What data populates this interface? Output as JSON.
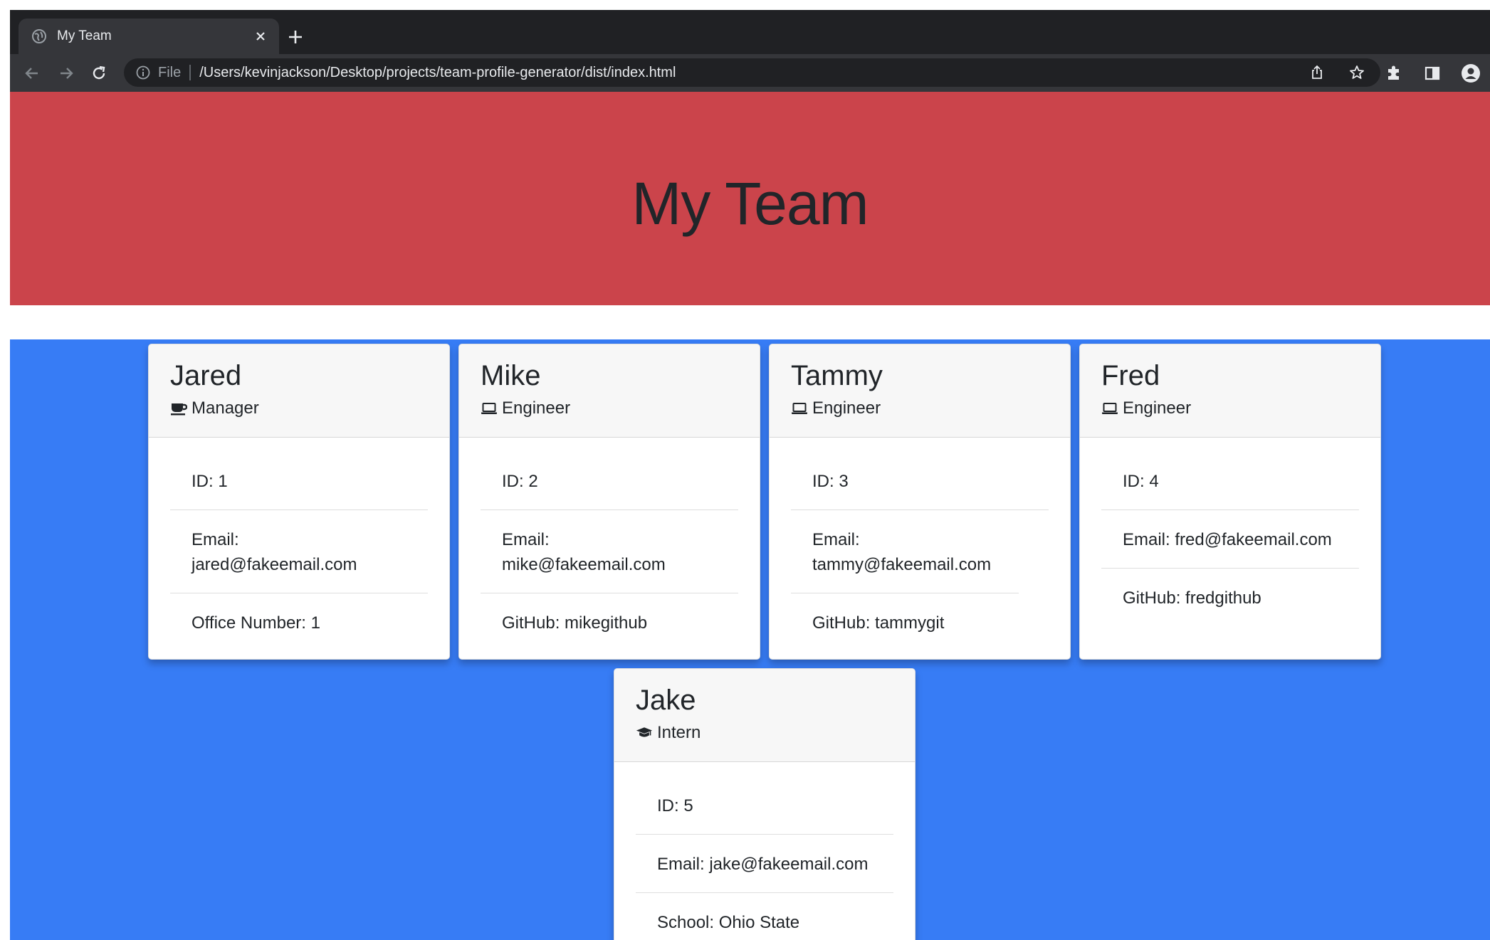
{
  "browser": {
    "tab_title": "My Team",
    "new_tab": "+",
    "url_scheme": "File",
    "url": "/Users/kevinjackson/Desktop/projects/team-profile-generator/dist/index.html"
  },
  "page": {
    "heading": "My Team"
  },
  "cards": [
    {
      "name": "Jared",
      "role": "Manager",
      "role_icon": "coffee-icon",
      "id": "ID: 1",
      "email": "Email: jared@fakeemail.com",
      "extra": "Office Number: 1"
    },
    {
      "name": "Mike",
      "role": "Engineer",
      "role_icon": "laptop-icon",
      "id": "ID: 2",
      "email": "Email: mike@fakeemail.com",
      "extra": "GitHub: mikegithub"
    },
    {
      "name": "Tammy",
      "role": "Engineer",
      "role_icon": "laptop-icon",
      "id": "ID: 3",
      "email": "Email: tammy@fakeemail.com",
      "extra": "GitHub: tammygit"
    },
    {
      "name": "Fred",
      "role": "Engineer",
      "role_icon": "laptop-icon",
      "id": "ID: 4",
      "email": "Email: fred@fakeemail.com",
      "extra": "GitHub: fredgithub"
    },
    {
      "name": "Jake",
      "role": "Intern",
      "role_icon": "graduation-cap-icon",
      "id": "ID: 5",
      "email": "Email: jake@fakeemail.com",
      "extra": "School: Ohio State"
    }
  ],
  "colors": {
    "header_bg": "#cb444b",
    "team_bg": "#377cf5"
  }
}
